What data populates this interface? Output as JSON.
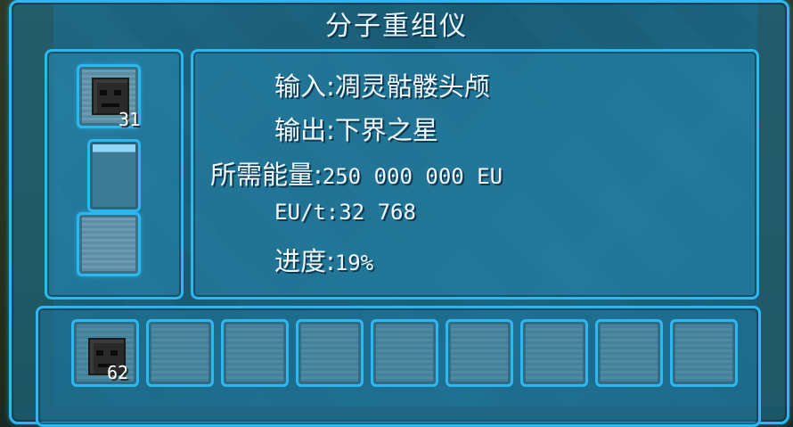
{
  "machine": {
    "title": "分子重组仪"
  },
  "input_slot": {
    "item_icon": "wither-skeleton-skull-icon",
    "count": "31"
  },
  "output_slot": {
    "item_icon": "",
    "count": ""
  },
  "energy_bar": {
    "fill_percent": 15
  },
  "info": {
    "input_label": "输入:",
    "input_value": "凋灵骷髅头颅",
    "output_label": "输出:",
    "output_value": "下界之星",
    "energy_label": "所需能量:",
    "energy_value": "250 000 000 EU",
    "eut_label": "EU/t:",
    "eut_value": "32 768",
    "progress_label": "进度:",
    "progress_value": "19%"
  },
  "inventory": {
    "slots": [
      {
        "item_icon": "wither-skeleton-skull-icon",
        "count": "62"
      },
      {
        "item_icon": "",
        "count": ""
      },
      {
        "item_icon": "",
        "count": ""
      },
      {
        "item_icon": "",
        "count": ""
      },
      {
        "item_icon": "",
        "count": ""
      },
      {
        "item_icon": "",
        "count": ""
      },
      {
        "item_icon": "",
        "count": ""
      },
      {
        "item_icon": "",
        "count": ""
      },
      {
        "item_icon": "",
        "count": ""
      }
    ]
  },
  "colors": {
    "accent": "#2bb8f0",
    "panel": "#2a8cb4",
    "text": "#f2f8ff"
  }
}
